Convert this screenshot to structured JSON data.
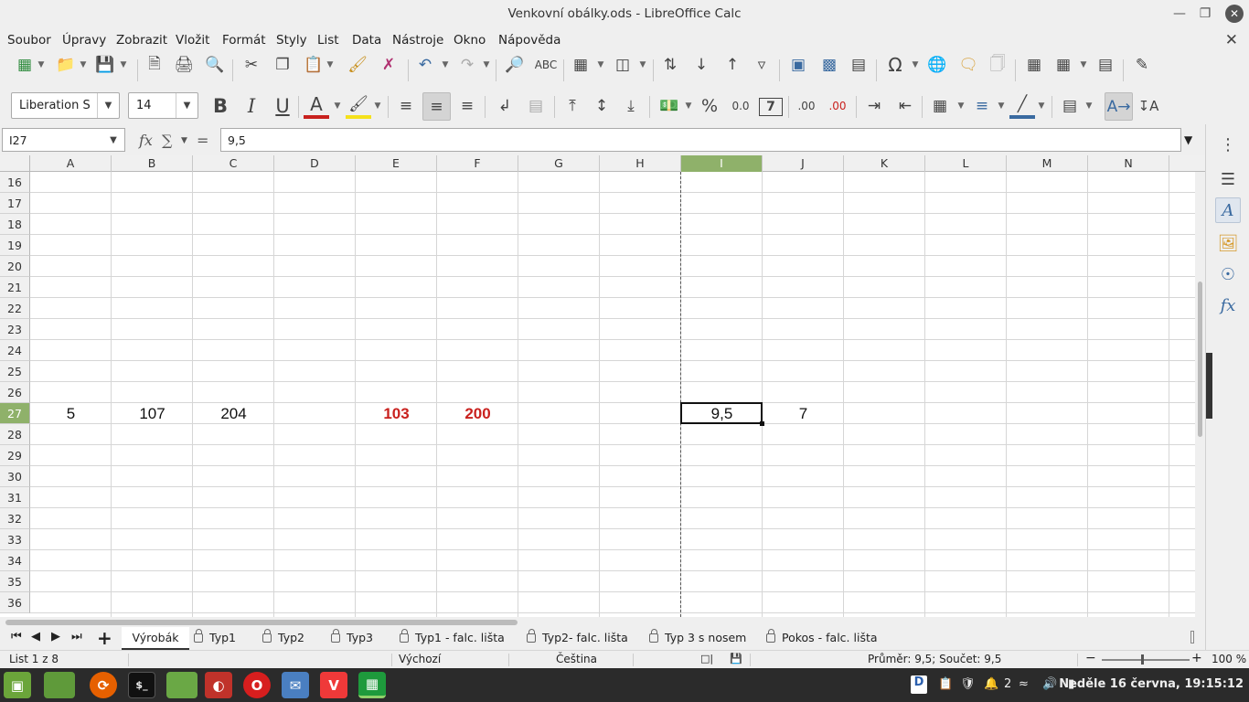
{
  "window": {
    "title": "Venkovní obálky.ods - LibreOffice Calc"
  },
  "menu": [
    "Soubor",
    "Úpravy",
    "Zobrazit",
    "Vložit",
    "Formát",
    "Styly",
    "List",
    "Data",
    "Nástroje",
    "Okno",
    "Nápověda"
  ],
  "format": {
    "font_name": "Liberation S",
    "font_size": "14",
    "percent": "%",
    "number": "0.0",
    "decimals_add": ".00",
    "decimals_remove": ".00"
  },
  "formula": {
    "cell_ref": "I27",
    "content": "9,5",
    "fx": "fx",
    "sum": "∑",
    "equals": "="
  },
  "grid": {
    "columns": [
      "A",
      "B",
      "C",
      "D",
      "E",
      "F",
      "G",
      "H",
      "I",
      "J",
      "K",
      "L",
      "M",
      "N"
    ],
    "rows": [
      "16",
      "17",
      "18",
      "19",
      "20",
      "21",
      "22",
      "23",
      "24",
      "25",
      "26",
      "27",
      "28",
      "29",
      "30",
      "31",
      "32",
      "33",
      "34",
      "35",
      "36"
    ],
    "selected_column": "I",
    "selected_row": "27",
    "row27": {
      "A": "5",
      "B": "107",
      "C": "204",
      "E": "103",
      "F": "200",
      "I": "9,5",
      "J": "7"
    },
    "accent_red": "#c9211e",
    "selection_green": "#8fb16a"
  },
  "sheets": [
    "Výrobák",
    "Typ1",
    "Typ2",
    "Typ3",
    "Typ1 - falc. lišta",
    "Typ2- falc. lišta",
    "Typ 3 s nosem",
    "Pokos - falc. lišta"
  ],
  "active_sheet": "Výrobák",
  "status": {
    "sheet_info": "List 1 z 8",
    "page_style": "Výchozí",
    "language": "Čeština",
    "summary": "Průměr: 9,5; Součet: 9,5",
    "zoom": "100 %",
    "zoom_fraction": 0.45
  },
  "taskbar": {
    "workspace": "2",
    "clock": "Neděle 16 června, 19:15:12",
    "apps": [
      "mint-menu",
      "files-green",
      "firefox",
      "terminal",
      "files",
      "prism",
      "opera",
      "mail",
      "vivaldi",
      "calc"
    ],
    "terminal_label": "$_"
  }
}
